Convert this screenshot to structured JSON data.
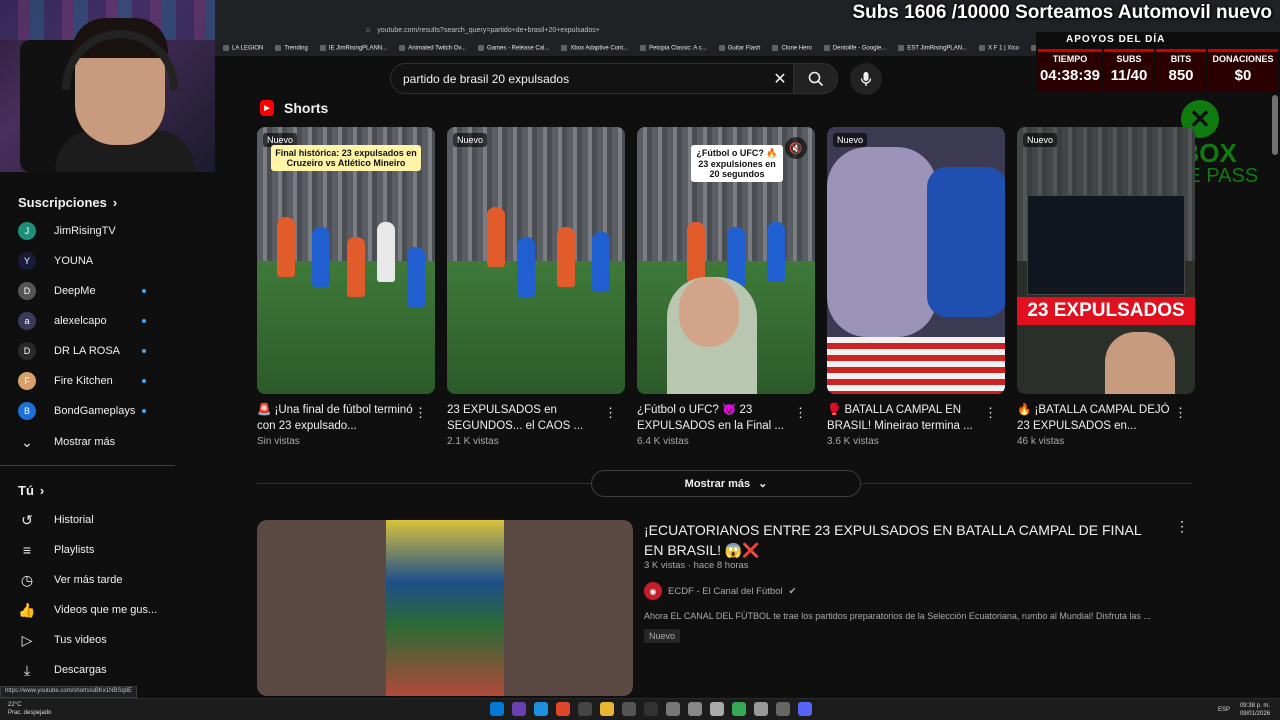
{
  "overlay": {
    "subs_banner": "Subs 1606 /10000 Sorteamos Automovil nuevo",
    "stats_title": "APOYOS DEL DÍA",
    "stats": [
      {
        "label": "TIEMPO",
        "value": "04:38:39"
      },
      {
        "label": "SUBS",
        "value": "11/40"
      },
      {
        "label": "BITS",
        "value": "850"
      },
      {
        "label": "DONACIONES",
        "value": "$0"
      }
    ],
    "xbox_line1": "XBOX",
    "xbox_line2": "GAME PASS"
  },
  "browser": {
    "url": "youtube.com/results?search_query=partido+de+brasil+20+expulsados+",
    "bookmarks": [
      "LA LEGION",
      "Trending",
      "IE JimRisingPLANN...",
      "Animated Twitch Ov...",
      "Games - Release Cal...",
      "Xbox Adaptive Cont...",
      "Petopia Classic: A c...",
      "Guitar Flash",
      "Clone Hero",
      "Dentolife - Google...",
      "EST JimRisingPLAN...",
      "X F 1 | Xico",
      "Home | Demolie"
    ]
  },
  "search": {
    "query": "partido de brasil 20 expulsados"
  },
  "sidebar": {
    "subscriptions_title": "Suscripciones",
    "subscriptions": [
      {
        "name": "JimRisingTV",
        "initial": "J",
        "color": "#1f8f7a",
        "dot": false
      },
      {
        "name": "YOUNA",
        "initial": "Y",
        "color": "#1a1a3a",
        "dot": false
      },
      {
        "name": "DeepMe",
        "initial": "D",
        "color": "#555555",
        "dot": true
      },
      {
        "name": "alexelcapo",
        "initial": "a",
        "color": "#3a3a5a",
        "dot": true
      },
      {
        "name": "DR LA ROSA",
        "initial": "D",
        "color": "#2a2a2a",
        "dot": true
      },
      {
        "name": "Fire Kitchen",
        "initial": "F",
        "color": "#d9a06b",
        "dot": true
      },
      {
        "name": "BondGameplays",
        "initial": "B",
        "color": "#1e6fd9",
        "dot": true
      }
    ],
    "show_more": "Mostrar más",
    "you_title": "Tú",
    "you_items": [
      {
        "label": "Historial",
        "icon": "↺"
      },
      {
        "label": "Playlists",
        "icon": "≡"
      },
      {
        "label": "Ver más tarde",
        "icon": "◷"
      },
      {
        "label": "Videos que me gus...",
        "icon": "👍"
      },
      {
        "label": "Tus videos",
        "icon": "▷"
      },
      {
        "label": "Descargas",
        "icon": "⤓"
      }
    ]
  },
  "shorts": {
    "section_title": "Shorts",
    "items": [
      {
        "badge": "Nuevo",
        "caption": "Final histórica: 23 expulsados en Cruzeiro vs Atlético Mineiro",
        "title": "🚨 ¡Una final de fútbol terminó con 23 expulsado...",
        "views": "Sin vistas"
      },
      {
        "badge": "Nuevo",
        "caption": "",
        "title": "23 EXPULSADOS en SEGUNDOS... el CAOS ...",
        "views": "2.1 K vistas"
      },
      {
        "badge": "",
        "caption": "¿Fútbol o UFC? 🔥23 expulsiones en 20 segundos",
        "title": "¿Fútbol o UFC? 😈 23 EXPULSADOS  en la Final ...",
        "views": "6.4 K vistas"
      },
      {
        "badge": "Nuevo",
        "caption": "",
        "title": "🥊 BATALLA CAMPAL EN BRASIL! Mineirao termina ...",
        "views": "3.6 K vistas"
      },
      {
        "badge": "Nuevo",
        "caption": "",
        "overlay": "23 EXPULSADOS",
        "title": "🔥 ¡BATALLA CAMPAL DEJÓ 23 EXPULSADOS en...",
        "views": "46 k vistas"
      }
    ],
    "show_more": "Mostrar más"
  },
  "video": {
    "title": "¡ECUATORIANOS ENTRE 23 EXPULSADOS EN BATALLA CAMPAL DE FINAL EN BRASIL! 😱❌",
    "meta": "3 K vistas · hace 8 horas",
    "channel": "ECDF - El Canal del Fútbol",
    "description": "Ahora EL CANAL DEL FÚTBOL te trae los partidos preparatorios de la Selección Ecuatoriana, rumbo al Mundial! Disfruta las ...",
    "badge": "Nuevo"
  },
  "status_url": "https://www.youtube.com/shorts/uBKx1NBSq8E",
  "taskbar": {
    "temp": "22°C",
    "weather": "Prac. despejado",
    "lang": "ESP",
    "time": "09:38 p. m.",
    "date": "09/01/2026"
  }
}
